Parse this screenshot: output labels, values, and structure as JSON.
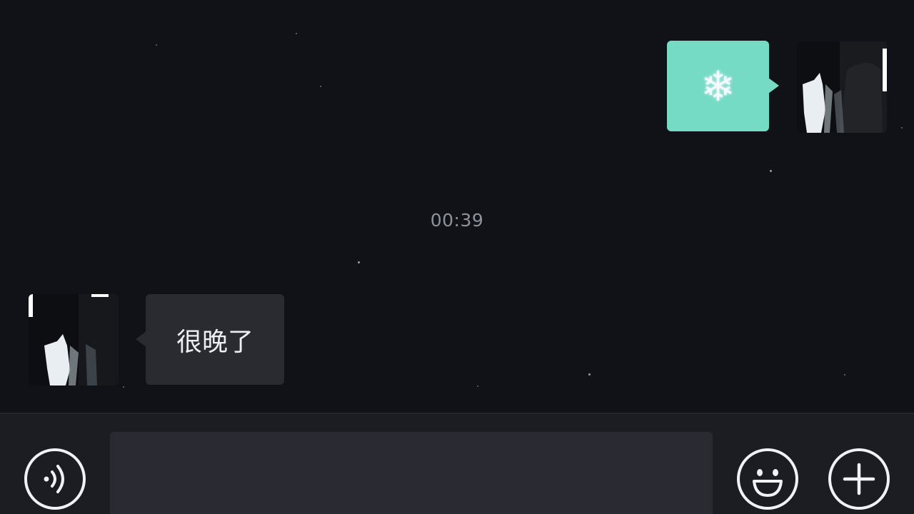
{
  "chat": {
    "messages": [
      {
        "direction": "outgoing",
        "content_type": "emoji",
        "emoji": "❄",
        "bubble_color": "#76dbc4"
      },
      {
        "direction": "incoming",
        "content_type": "text",
        "text": "很晚了",
        "bubble_color": "#2a2b30"
      }
    ],
    "timestamp": "00:39"
  },
  "input_bar": {
    "voice_icon": "voice-icon",
    "emoji_icon": "smiley-icon",
    "more_icon": "plus-icon",
    "input_value": "",
    "input_placeholder": ""
  },
  "theme": {
    "background": "#111217",
    "accent": "#76dbc4",
    "input_bar": "#1c1d22"
  }
}
